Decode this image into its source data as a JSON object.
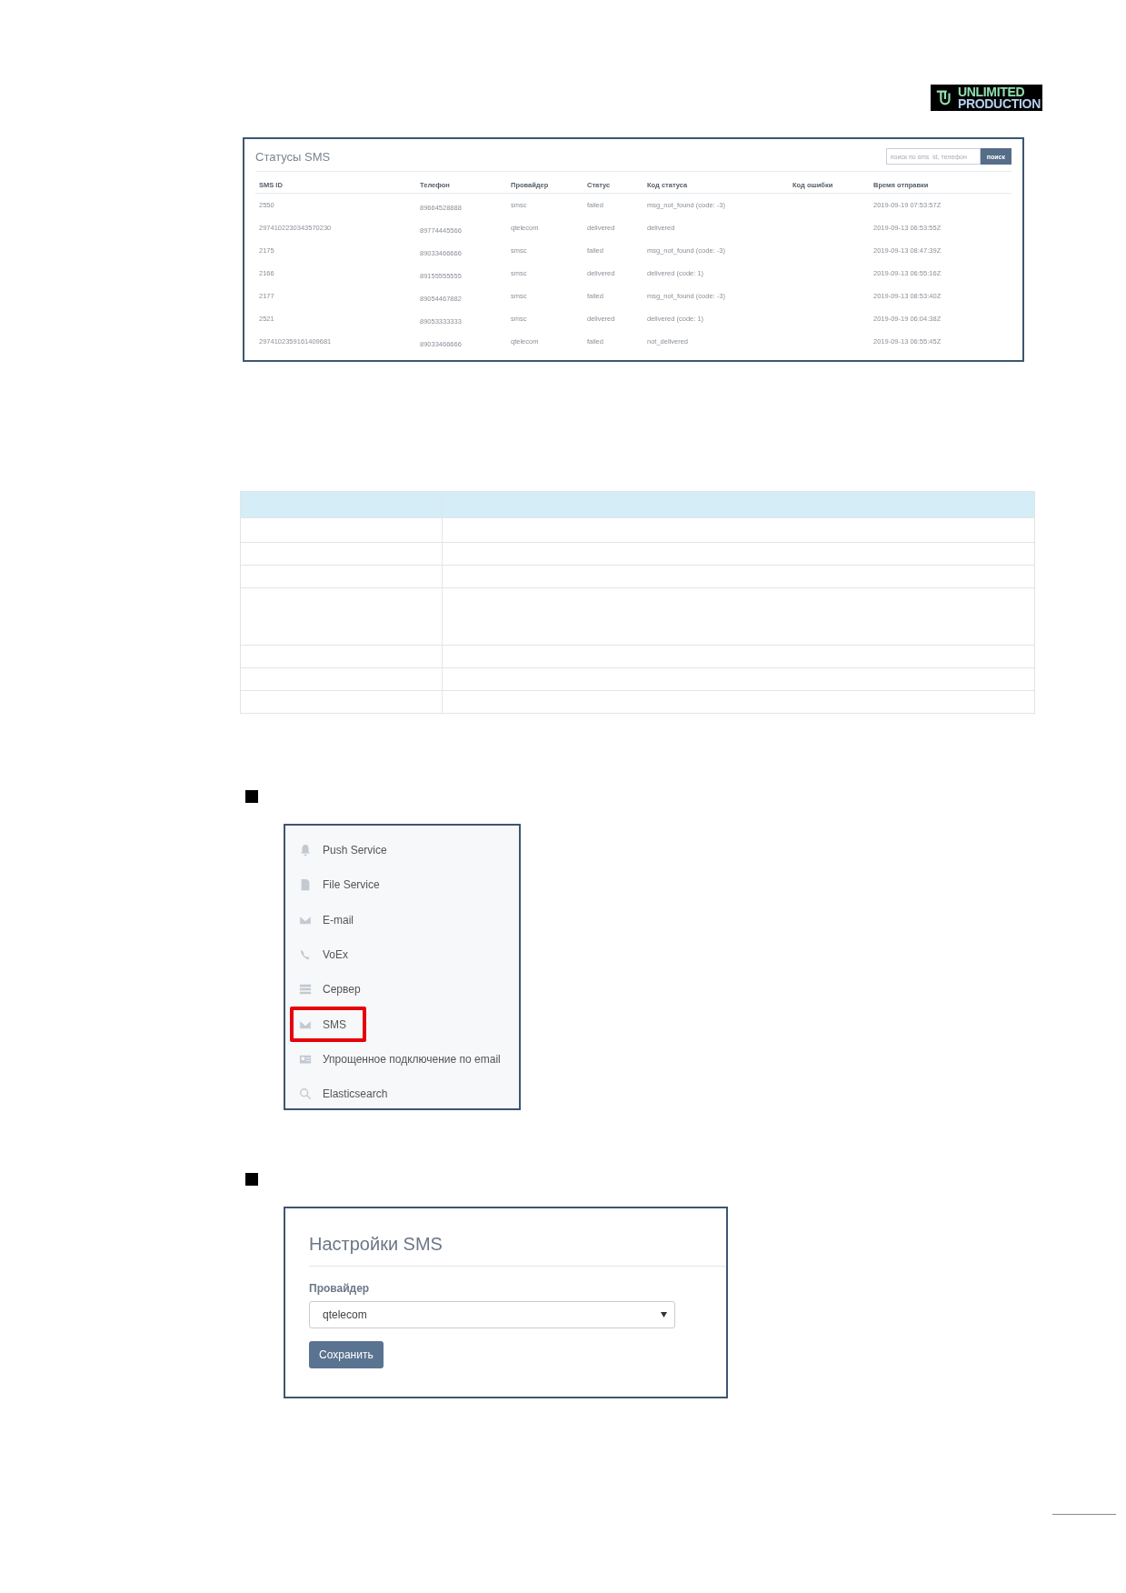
{
  "logo": {
    "line_1": "UNLIMITED",
    "line_2": "PRODUCTION"
  },
  "sms_statuses": {
    "title": "Статусы SMS",
    "search": {
      "placeholder": "поиск по sms_id, телефон"
    },
    "search_button": "поиск",
    "columns": [
      "SMS ID",
      "Телефон",
      "Провайдер",
      "Статус",
      "Код статуса",
      "Код ошибки",
      "Время отправки"
    ],
    "rows": [
      {
        "sms_id": "2550",
        "phone": "89664528888",
        "provider": "smsc",
        "status": "failed",
        "status_code": "msg_not_found (code: -3)",
        "sent_time": "2019-09-19 07:53:57Z"
      },
      {
        "sms_id": "2974102230343570230",
        "phone": "89774445566",
        "provider": "qtelecom",
        "status": "delivered",
        "status_code": "delivered",
        "sent_time": "2019-09-13 06:53:55Z"
      },
      {
        "sms_id": "2175",
        "phone": "89033466666",
        "provider": "smsc",
        "status": "failed",
        "status_code": "msg_not_found (code: -3)",
        "sent_time": "2019-09-13 08:47:39Z"
      },
      {
        "sms_id": "2166",
        "phone": "89155555555",
        "provider": "smsc",
        "status": "delivered",
        "status_code": "delivered (code: 1)",
        "sent_time": "2019-09-13 06:55:16Z"
      },
      {
        "sms_id": "2177",
        "phone": "89054467882",
        "provider": "smsc",
        "status": "failed",
        "status_code": "msg_not_found (code: -3)",
        "sent_time": "2019-09-13 08:53:40Z"
      },
      {
        "sms_id": "2521",
        "phone": "89053333333",
        "provider": "smsc",
        "status": "delivered",
        "status_code": "delivered (code: 1)",
        "sent_time": "2019-09-19 06:04:38Z"
      },
      {
        "sms_id": "2974102359161409681",
        "phone": "89033466666",
        "provider": "qtelecom",
        "status": "failed",
        "status_code": "not_delivered",
        "sent_time": "2019-09-13 06:55:45Z"
      }
    ]
  },
  "navigation": {
    "items": [
      {
        "label": "Push Service",
        "highlighted": false
      },
      {
        "label": "File Service",
        "highlighted": false
      },
      {
        "label": "E-mail",
        "highlighted": false
      },
      {
        "label": "VoEx",
        "highlighted": false
      },
      {
        "label": "Сервер",
        "highlighted": false
      },
      {
        "label": "SMS",
        "highlighted": true
      },
      {
        "label": "Упрощенное подключение по email",
        "highlighted": false
      },
      {
        "label": "Elasticsearch",
        "highlighted": false
      }
    ]
  },
  "sms_settings": {
    "title": "Настройки SMS",
    "provider_label": "Провайдер",
    "provider": "qtelecom",
    "save_button": "Сохранить"
  }
}
